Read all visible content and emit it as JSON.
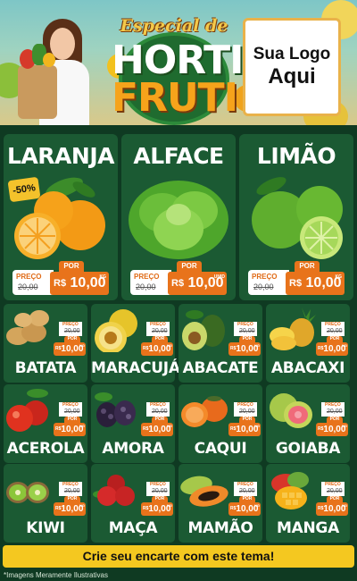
{
  "header": {
    "especial": "Especial de",
    "horti": "HORTI",
    "fruti": "FRUTI",
    "logo_line1": "Sua Logo",
    "logo_line2": "Aqui"
  },
  "top_products": [
    {
      "name": "LARANJA",
      "discount": "-50%",
      "price_label": "PREÇO",
      "old_price": "20,00",
      "por": "POR",
      "currency": "R$",
      "price": "10,00",
      "unit": "KG"
    },
    {
      "name": "ALFACE",
      "price_label": "PREÇO",
      "old_price": "20,00",
      "por": "POR",
      "currency": "R$",
      "price": "10,00",
      "unit": "UNID"
    },
    {
      "name": "LIMÃO",
      "price_label": "PREÇO",
      "old_price": "20,00",
      "por": "POR",
      "currency": "R$",
      "price": "10,00",
      "unit": "KG"
    }
  ],
  "grid_products": [
    {
      "name": "BATATA",
      "price_label": "PREÇO",
      "old_price": "20,00",
      "por": "POR",
      "currency": "R$",
      "price": "10,00",
      "unit": "KG"
    },
    {
      "name": "MARACUJÁ",
      "price_label": "PREÇO",
      "old_price": "20,00",
      "por": "POR",
      "currency": "R$",
      "price": "10,00",
      "unit": "KG"
    },
    {
      "name": "ABACATE",
      "price_label": "PREÇO",
      "old_price": "20,00",
      "por": "POR",
      "currency": "R$",
      "price": "10,00",
      "unit": "KG"
    },
    {
      "name": "ABACAXI",
      "price_label": "PREÇO",
      "old_price": "20,00",
      "por": "POR",
      "currency": "R$",
      "price": "10,00",
      "unit": "KG"
    },
    {
      "name": "ACEROLA",
      "price_label": "PREÇO",
      "old_price": "20,00",
      "por": "POR",
      "currency": "R$",
      "price": "10,00",
      "unit": "KG"
    },
    {
      "name": "AMORA",
      "price_label": "PREÇO",
      "old_price": "20,00",
      "por": "POR",
      "currency": "R$",
      "price": "10,00",
      "unit": "KG"
    },
    {
      "name": "CAQUI",
      "price_label": "PREÇO",
      "old_price": "20,00",
      "por": "POR",
      "currency": "R$",
      "price": "10,00",
      "unit": "KG"
    },
    {
      "name": "GOIABA",
      "price_label": "PREÇO",
      "old_price": "20,00",
      "por": "POR",
      "currency": "R$",
      "price": "10,00",
      "unit": "KG"
    },
    {
      "name": "KIWI",
      "price_label": "PREÇO",
      "old_price": "20,00",
      "por": "POR",
      "currency": "R$",
      "price": "10,00",
      "unit": "KG"
    },
    {
      "name": "MAÇA",
      "price_label": "PREÇO",
      "old_price": "20,00",
      "por": "POR",
      "currency": "R$",
      "price": "10,00",
      "unit": "KG"
    },
    {
      "name": "MAMÃO",
      "price_label": "PREÇO",
      "old_price": "20,00",
      "por": "POR",
      "currency": "R$",
      "price": "10,00",
      "unit": "KG"
    },
    {
      "name": "MANGA",
      "price_label": "PREÇO",
      "old_price": "20,00",
      "por": "POR",
      "currency": "R$",
      "price": "10,00",
      "unit": "KG"
    }
  ],
  "cta": "Crie seu encarte com este tema!",
  "disclaimer": "*Imagens Meramente Ilustrativas",
  "colors": {
    "background": "#0f3a22",
    "card": "#1b5a33",
    "price": "#e8731b",
    "cta": "#f4c820"
  }
}
